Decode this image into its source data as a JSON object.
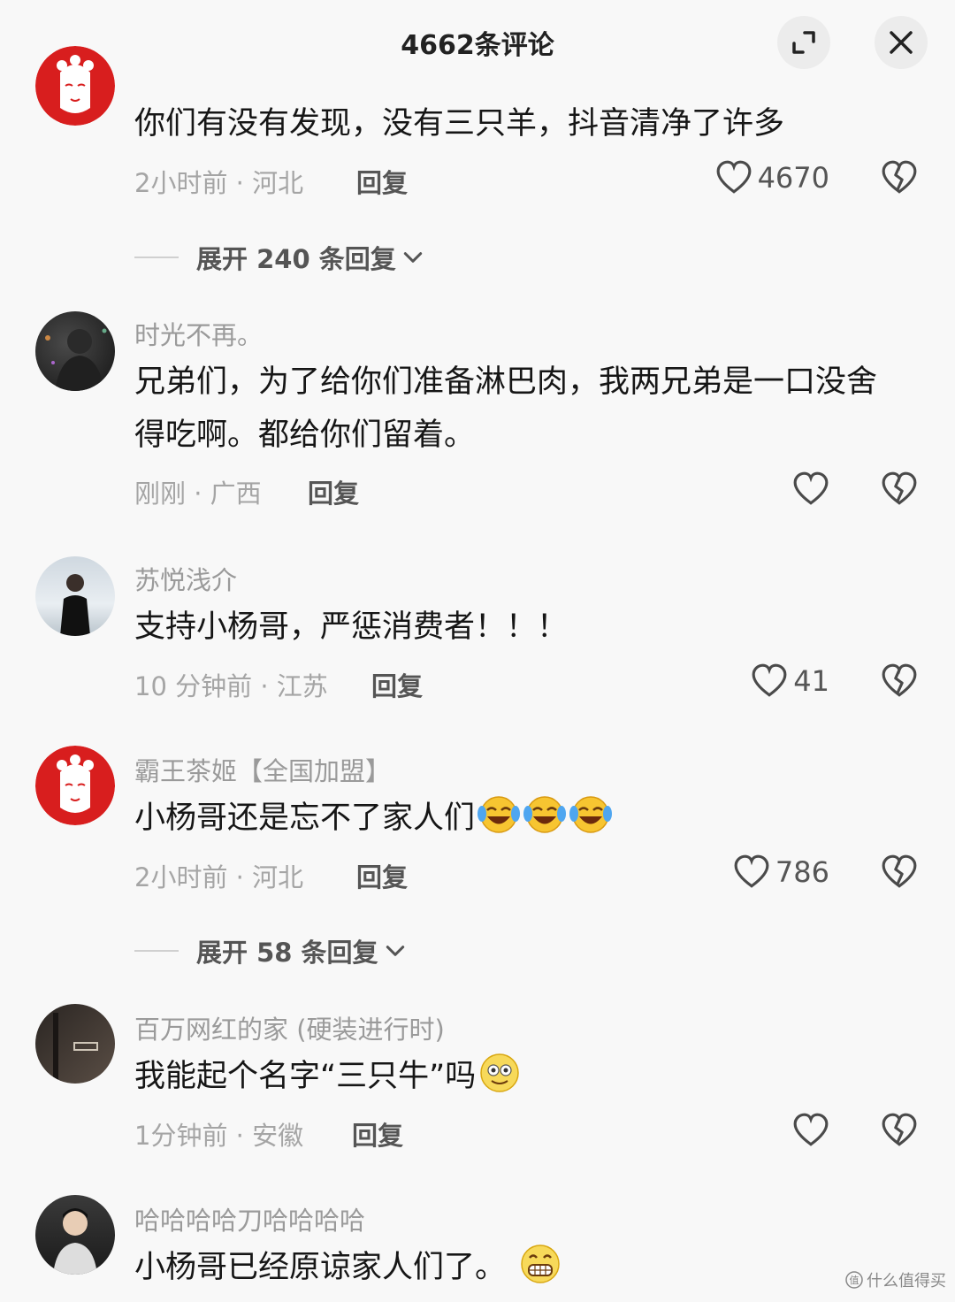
{
  "header": {
    "title": "4662条评论"
  },
  "comments": [
    {
      "username": "",
      "text": "你们有没有发现，没有三只羊，抖音清净了许多",
      "time_location": "2小时前 · 河北",
      "reply_label": "回复",
      "likes": "4670",
      "expand_label": "展开 240 条回复",
      "avatar_icon": "opera-mask-avatar"
    },
    {
      "username": "时光不再。",
      "text_lines": [
        "兄弟们，为了给你们准备淋巴肉，我两兄弟是一口没舍",
        "得吃啊。都给你们留着。"
      ],
      "time_location": "刚刚 · 广西",
      "reply_label": "回复",
      "likes": "",
      "avatar_icon": "dark-photo-avatar"
    },
    {
      "username": "苏悦浅介",
      "text": "支持小杨哥，严惩消费者！！！",
      "time_location": "10 分钟前 · 江苏",
      "reply_label": "回复",
      "likes": "41",
      "avatar_icon": "person-photo-avatar"
    },
    {
      "username": "霸王茶姬【全国加盟】",
      "text": "小杨哥还是忘不了家人们",
      "emojis": [
        "laugh-cry-emoji",
        "laugh-cry-emoji",
        "laugh-cry-emoji"
      ],
      "time_location": "2小时前 · 河北",
      "reply_label": "回复",
      "likes": "786",
      "expand_label": "展开 58 条回复",
      "avatar_icon": "opera-mask-avatar"
    },
    {
      "username": "百万网红的家 (硬装进行时)",
      "text": "我能起个名字“三只牛”吗",
      "emojis": [
        "dizzy-smile-emoji"
      ],
      "time_location": "1分钟前 · 安徽",
      "reply_label": "回复",
      "likes": "",
      "avatar_icon": "door-photo-avatar"
    },
    {
      "username": "哈哈哈哈刀哈哈哈哈",
      "text": "小杨哥已经原谅家人们了。",
      "emojis": [
        "grin-emoji"
      ],
      "avatar_icon": "person-photo-avatar"
    }
  ],
  "watermark": "什么值得买",
  "colors": {
    "background": "#f8f8f8",
    "accent_red": "#d81e1e",
    "meta_gray": "#a5a5a5"
  }
}
